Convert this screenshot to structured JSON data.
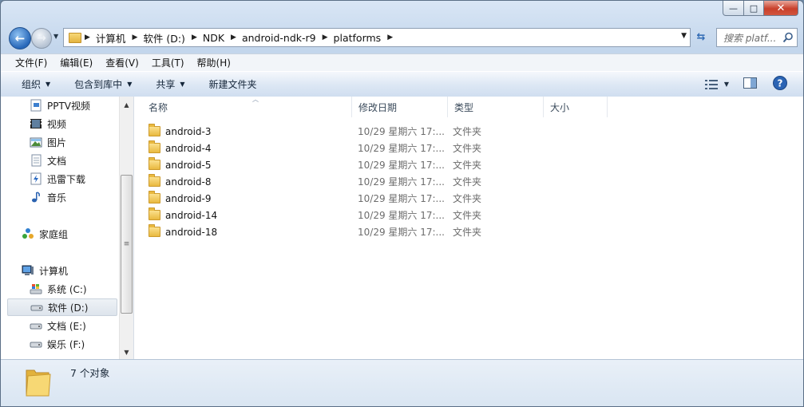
{
  "window": {
    "min_label": "—",
    "max_label": "□",
    "close_label": "✕"
  },
  "address": {
    "crumbs": [
      "计算机",
      "软件 (D:)",
      "NDK",
      "android-ndk-r9",
      "platforms"
    ],
    "search_placeholder": "搜索 platf..."
  },
  "menu": [
    "文件(F)",
    "编辑(E)",
    "查看(V)",
    "工具(T)",
    "帮助(H)"
  ],
  "toolbar": {
    "organize": "组织",
    "include_in_library": "包含到库中",
    "share": "共享",
    "new_folder": "新建文件夹"
  },
  "nav": {
    "libraries": [
      {
        "label": "PPTV视频",
        "icon": "pptv-video-icon"
      },
      {
        "label": "视频",
        "icon": "video-library-icon"
      },
      {
        "label": "图片",
        "icon": "pictures-library-icon"
      },
      {
        "label": "文档",
        "icon": "documents-library-icon"
      },
      {
        "label": "迅雷下载",
        "icon": "thunder-download-icon"
      },
      {
        "label": "音乐",
        "icon": "music-library-icon"
      }
    ],
    "homegroup": "家庭组",
    "computer": "计算机",
    "drives": [
      {
        "label": "系统 (C:)",
        "icon": "system-drive-icon"
      },
      {
        "label": "软件 (D:)",
        "icon": "hard-drive-icon",
        "selected": true
      },
      {
        "label": "文档 (E:)",
        "icon": "hard-drive-icon"
      },
      {
        "label": "娱乐 (F:)",
        "icon": "hard-drive-icon"
      }
    ]
  },
  "columns": {
    "name": "名称",
    "date": "修改日期",
    "type": "类型",
    "size": "大小"
  },
  "files": [
    {
      "name": "android-3",
      "date": "10/29 星期六 17:...",
      "type": "文件夹"
    },
    {
      "name": "android-4",
      "date": "10/29 星期六 17:...",
      "type": "文件夹"
    },
    {
      "name": "android-5",
      "date": "10/29 星期六 17:...",
      "type": "文件夹"
    },
    {
      "name": "android-8",
      "date": "10/29 星期六 17:...",
      "type": "文件夹"
    },
    {
      "name": "android-9",
      "date": "10/29 星期六 17:...",
      "type": "文件夹"
    },
    {
      "name": "android-14",
      "date": "10/29 星期六 17:...",
      "type": "文件夹"
    },
    {
      "name": "android-18",
      "date": "10/29 星期六 17:...",
      "type": "文件夹"
    }
  ],
  "status": {
    "count": "7 个对象"
  }
}
